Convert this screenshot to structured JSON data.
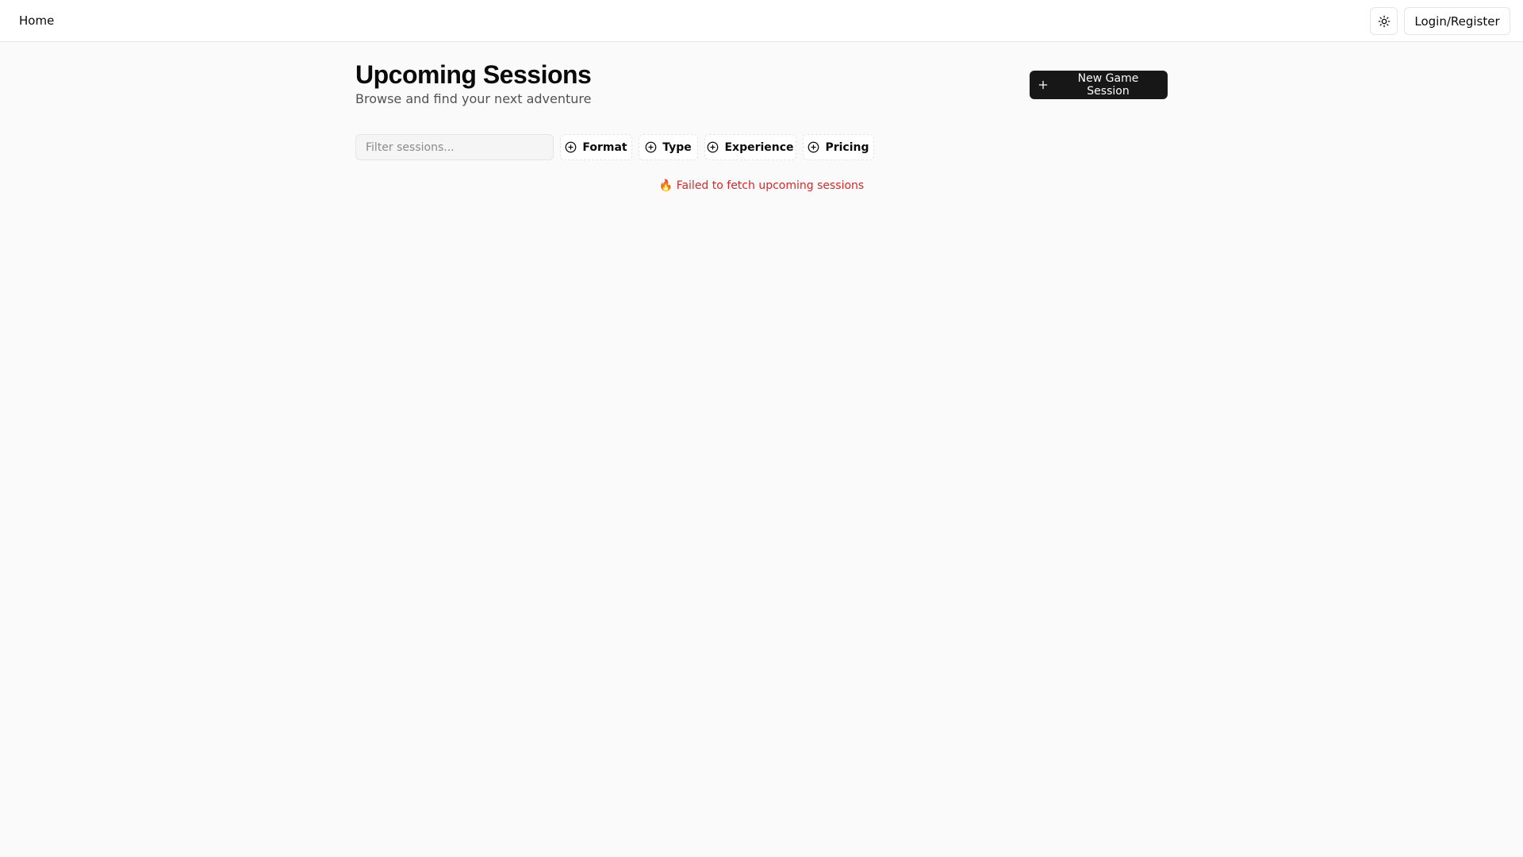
{
  "topbar": {
    "home_label": "Home",
    "theme_icon": "sun-icon",
    "login_label": "Login/Register"
  },
  "main": {
    "title": "Upcoming Sessions",
    "subtitle": "Browse and find your next adventure",
    "new_session_label": "New Game Session",
    "new_session_icon": "plus-icon"
  },
  "filters": {
    "search_placeholder": "Filter sessions...",
    "facets": [
      {
        "label": "Format",
        "icon": "plus-circle-icon"
      },
      {
        "label": "Type",
        "icon": "plus-circle-icon"
      },
      {
        "label": "Experience",
        "icon": "plus-circle-icon"
      },
      {
        "label": "Pricing",
        "icon": "plus-circle-icon"
      }
    ]
  },
  "status": {
    "error_icon": "🔥",
    "error_text": "Failed to fetch upcoming sessions"
  },
  "colors": {
    "background": "#fafafa",
    "primary_button": "#171717",
    "error": "#dc2626"
  }
}
